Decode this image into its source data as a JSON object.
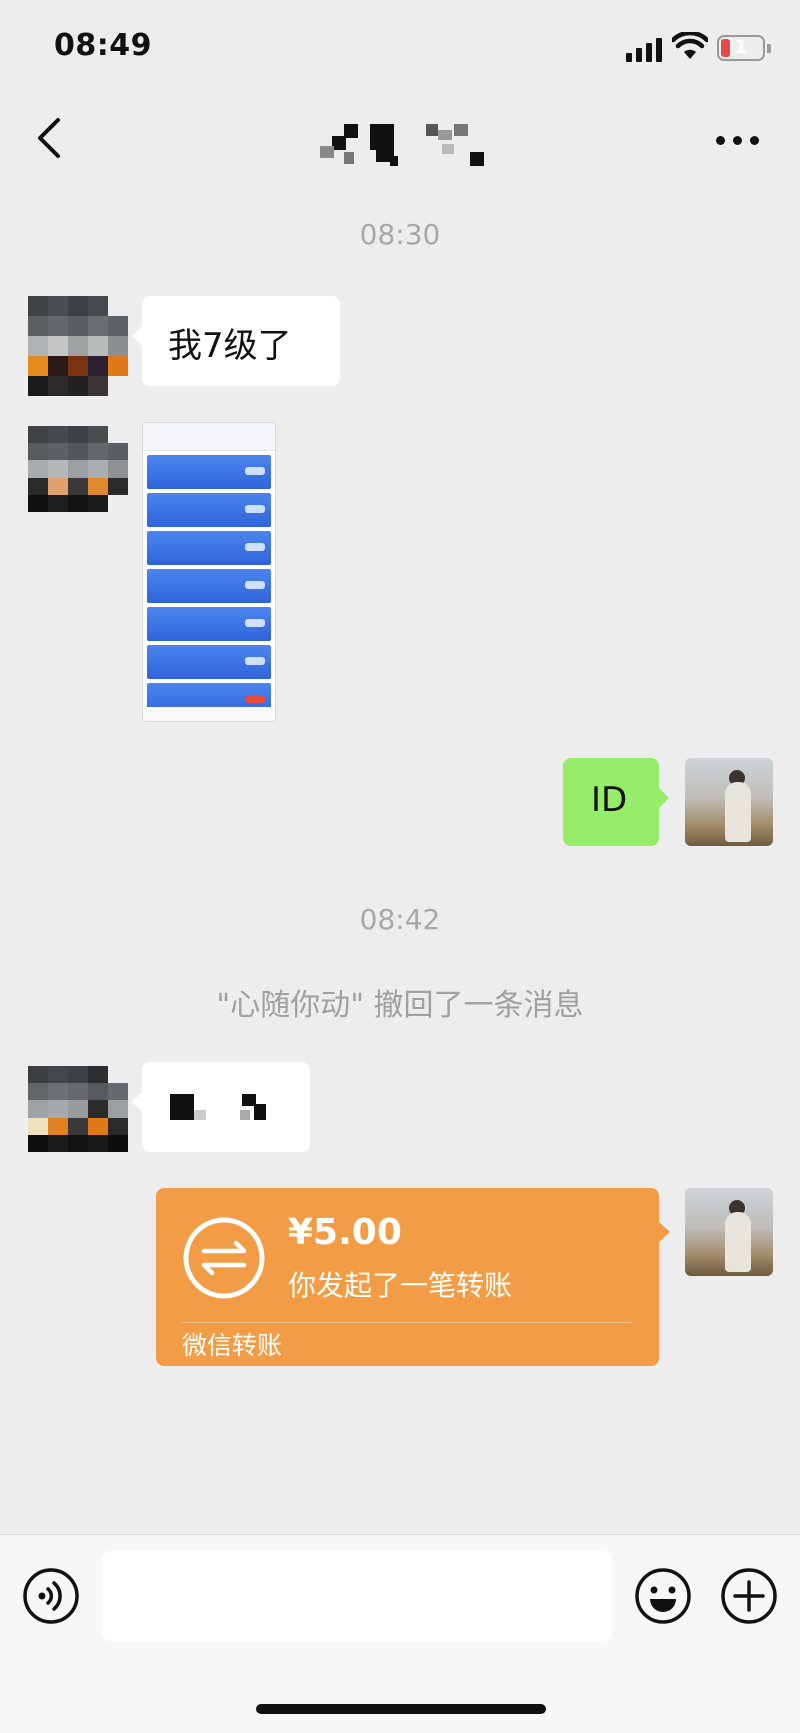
{
  "status_bar": {
    "time": "08:49",
    "battery_level": "1",
    "icons": [
      "signal-icon",
      "wifi-icon",
      "battery-icon"
    ]
  },
  "nav": {
    "title": "",
    "title_obscured": true,
    "icons": [
      "back-icon",
      "more-icon"
    ]
  },
  "messages": [
    {
      "type": "timestamp",
      "text": "08:30"
    },
    {
      "type": "text",
      "side": "left",
      "text": "我7级了"
    },
    {
      "type": "image",
      "side": "left"
    },
    {
      "type": "text",
      "side": "right",
      "text": "ID"
    },
    {
      "type": "timestamp",
      "text": "08:42"
    },
    {
      "type": "system",
      "text": "\"心随你动\" 撤回了一条消息"
    },
    {
      "type": "text",
      "side": "left",
      "text": "",
      "obscured": true
    },
    {
      "type": "transfer",
      "side": "right",
      "amount": "¥5.00",
      "description": "你发起了一笔转账",
      "label": "微信转账"
    }
  ],
  "input_bar": {
    "placeholder": "",
    "icons": [
      "voice-icon",
      "emoji-icon",
      "plus-icon"
    ]
  },
  "colors": {
    "background": "#ededed",
    "self_bubble": "#95ec69",
    "other_bubble": "#ffffff",
    "transfer_card": "#f29d45",
    "timestamp_text": "#a8a8a8"
  }
}
